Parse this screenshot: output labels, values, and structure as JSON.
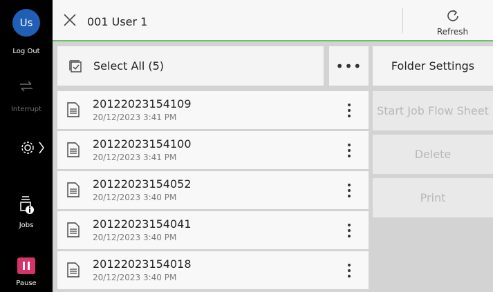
{
  "sidebar": {
    "avatar_text": "Us",
    "logout_label": "Log Out",
    "interrupt_label": "Interrupt",
    "jobs_label": "Jobs",
    "pause_label": "Pause"
  },
  "header": {
    "title": "001 User 1",
    "refresh_label": "Refresh"
  },
  "list": {
    "select_all_label": "Select All (5)",
    "more_label": "•••",
    "files": [
      {
        "name": "20122023154109",
        "date": "20/12/2023 3:41 PM"
      },
      {
        "name": "20122023154100",
        "date": "20/12/2023 3:41 PM"
      },
      {
        "name": "20122023154052",
        "date": "20/12/2023 3:40 PM"
      },
      {
        "name": "20122023154041",
        "date": "20/12/2023 3:40 PM"
      },
      {
        "name": "20122023154018",
        "date": "20/12/2023 3:40 PM"
      }
    ]
  },
  "actions": {
    "folder_settings": "Folder Settings",
    "start_job_flow_sheet": "Start Job Flow Sheet",
    "delete": "Delete",
    "print": "Print"
  },
  "colors": {
    "accent_green": "#6abf6a",
    "avatar_blue": "#1f5fb5",
    "pause_red": "#d6336a"
  }
}
